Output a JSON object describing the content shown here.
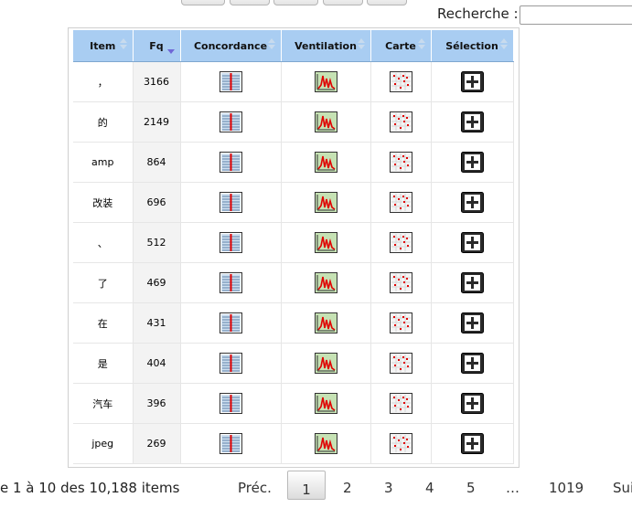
{
  "search": {
    "label": "Recherche :",
    "value": ""
  },
  "table": {
    "headers": [
      "Item",
      "Fq",
      "Concordance",
      "Ventilation",
      "Carte",
      "Sélection"
    ],
    "rows": [
      {
        "item": "，",
        "fq": "3166"
      },
      {
        "item": "的",
        "fq": "2149"
      },
      {
        "item": "amp",
        "fq": "864"
      },
      {
        "item": "改装",
        "fq": "696"
      },
      {
        "item": "、",
        "fq": "512"
      },
      {
        "item": "了",
        "fq": "469"
      },
      {
        "item": "在",
        "fq": "431"
      },
      {
        "item": "是",
        "fq": "404"
      },
      {
        "item": "汽车",
        "fq": "396"
      },
      {
        "item": "jpeg",
        "fq": "269"
      }
    ],
    "row_icons": [
      "concordance-icon",
      "ventilation-icon",
      "map-icon",
      "add-to-selection-icon"
    ]
  },
  "footer": {
    "info": "e 1 à 10 des 10,188 items",
    "prev": "Préc.",
    "pages": [
      "1",
      "2",
      "3",
      "4",
      "5",
      "…",
      "1019"
    ],
    "current_page": "1",
    "next": "Sui"
  },
  "colors": {
    "header_bg": "#a9cdf2",
    "sort_active": "#6f67d6",
    "fq_bg": "#f3f3f3"
  }
}
